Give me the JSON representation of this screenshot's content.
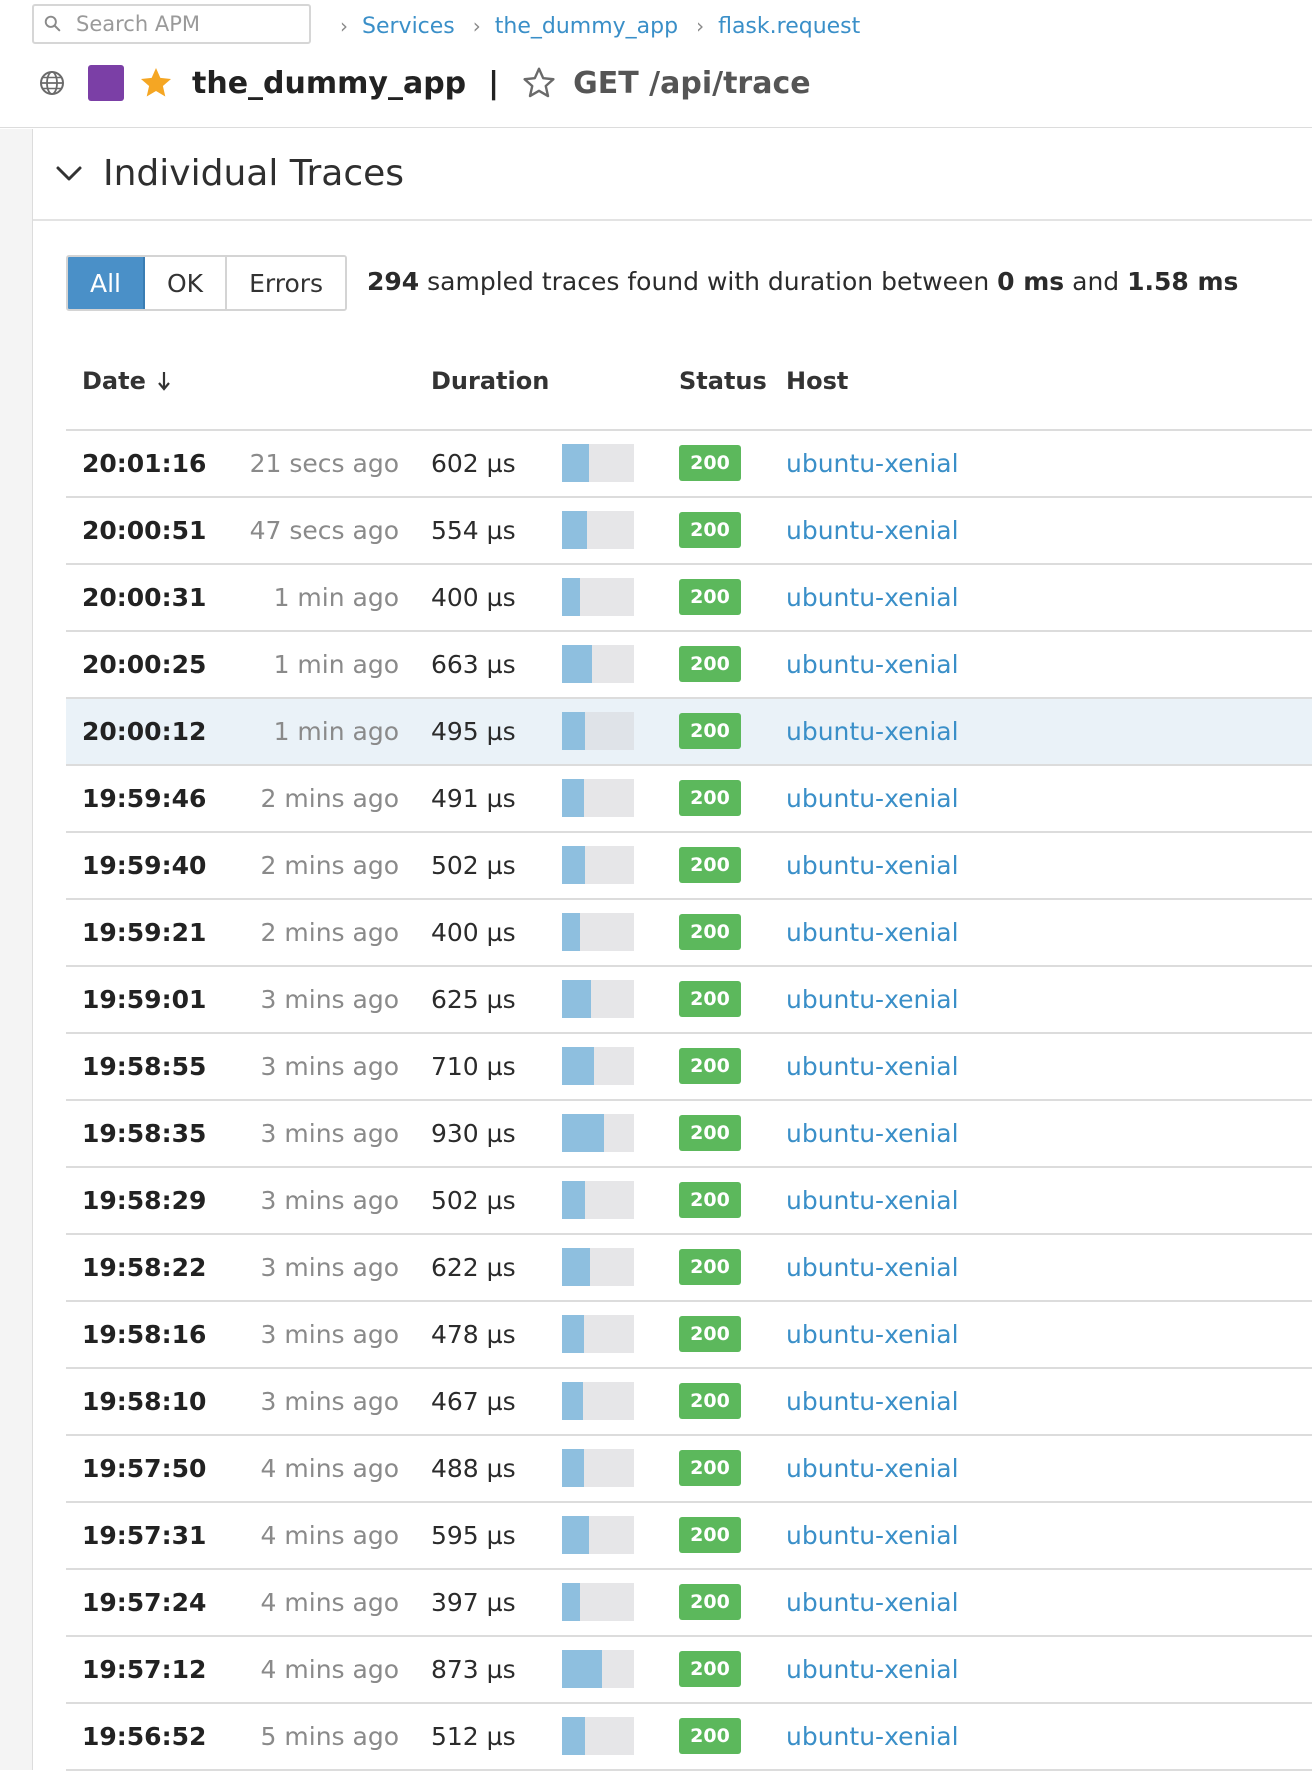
{
  "search": {
    "placeholder": "Search APM"
  },
  "breadcrumb": {
    "items": [
      {
        "label": "Services"
      },
      {
        "label": "the_dummy_app"
      },
      {
        "label": "flask.request"
      }
    ]
  },
  "header": {
    "service_color": "#7b3fa6",
    "service_name": "the_dummy_app",
    "separator": "|",
    "resource": "GET /api/trace",
    "icons": [
      "globe-icon",
      "star-filled-icon",
      "star-outline-icon"
    ]
  },
  "section": {
    "title": "Individual Traces"
  },
  "filters": {
    "options": [
      {
        "label": "All",
        "active": true
      },
      {
        "label": "OK",
        "active": false
      },
      {
        "label": "Errors",
        "active": false
      }
    ]
  },
  "summary": {
    "count": "294",
    "text_1": " sampled traces found with duration between ",
    "min": "0 ms",
    "text_2": " and ",
    "max": "1.58 ms"
  },
  "table": {
    "columns": {
      "date": "Date",
      "duration": "Duration",
      "status": "Status",
      "host": "Host"
    },
    "duration_bar_max_us": 1580,
    "rows": [
      {
        "time": "20:01:16",
        "ago": "21 secs ago",
        "duration": "602 µs",
        "duration_us": 602,
        "status": "200",
        "host": "ubuntu-xenial"
      },
      {
        "time": "20:00:51",
        "ago": "47 secs ago",
        "duration": "554 µs",
        "duration_us": 554,
        "status": "200",
        "host": "ubuntu-xenial"
      },
      {
        "time": "20:00:31",
        "ago": "1 min ago",
        "duration": "400 µs",
        "duration_us": 400,
        "status": "200",
        "host": "ubuntu-xenial"
      },
      {
        "time": "20:00:25",
        "ago": "1 min ago",
        "duration": "663 µs",
        "duration_us": 663,
        "status": "200",
        "host": "ubuntu-xenial"
      },
      {
        "time": "20:00:12",
        "ago": "1 min ago",
        "duration": "495 µs",
        "duration_us": 495,
        "status": "200",
        "host": "ubuntu-xenial",
        "hover": true
      },
      {
        "time": "19:59:46",
        "ago": "2 mins ago",
        "duration": "491 µs",
        "duration_us": 491,
        "status": "200",
        "host": "ubuntu-xenial"
      },
      {
        "time": "19:59:40",
        "ago": "2 mins ago",
        "duration": "502 µs",
        "duration_us": 502,
        "status": "200",
        "host": "ubuntu-xenial"
      },
      {
        "time": "19:59:21",
        "ago": "2 mins ago",
        "duration": "400 µs",
        "duration_us": 400,
        "status": "200",
        "host": "ubuntu-xenial"
      },
      {
        "time": "19:59:01",
        "ago": "3 mins ago",
        "duration": "625 µs",
        "duration_us": 625,
        "status": "200",
        "host": "ubuntu-xenial"
      },
      {
        "time": "19:58:55",
        "ago": "3 mins ago",
        "duration": "710 µs",
        "duration_us": 710,
        "status": "200",
        "host": "ubuntu-xenial"
      },
      {
        "time": "19:58:35",
        "ago": "3 mins ago",
        "duration": "930 µs",
        "duration_us": 930,
        "status": "200",
        "host": "ubuntu-xenial"
      },
      {
        "time": "19:58:29",
        "ago": "3 mins ago",
        "duration": "502 µs",
        "duration_us": 502,
        "status": "200",
        "host": "ubuntu-xenial"
      },
      {
        "time": "19:58:22",
        "ago": "3 mins ago",
        "duration": "622 µs",
        "duration_us": 622,
        "status": "200",
        "host": "ubuntu-xenial"
      },
      {
        "time": "19:58:16",
        "ago": "3 mins ago",
        "duration": "478 µs",
        "duration_us": 478,
        "status": "200",
        "host": "ubuntu-xenial"
      },
      {
        "time": "19:58:10",
        "ago": "3 mins ago",
        "duration": "467 µs",
        "duration_us": 467,
        "status": "200",
        "host": "ubuntu-xenial"
      },
      {
        "time": "19:57:50",
        "ago": "4 mins ago",
        "duration": "488 µs",
        "duration_us": 488,
        "status": "200",
        "host": "ubuntu-xenial"
      },
      {
        "time": "19:57:31",
        "ago": "4 mins ago",
        "duration": "595 µs",
        "duration_us": 595,
        "status": "200",
        "host": "ubuntu-xenial"
      },
      {
        "time": "19:57:24",
        "ago": "4 mins ago",
        "duration": "397 µs",
        "duration_us": 397,
        "status": "200",
        "host": "ubuntu-xenial"
      },
      {
        "time": "19:57:12",
        "ago": "4 mins ago",
        "duration": "873 µs",
        "duration_us": 873,
        "status": "200",
        "host": "ubuntu-xenial"
      },
      {
        "time": "19:56:52",
        "ago": "5 mins ago",
        "duration": "512 µs",
        "duration_us": 512,
        "status": "200",
        "host": "ubuntu-xenial"
      }
    ]
  },
  "colors": {
    "link": "#3a8fc8",
    "status_ok": "#5cb85c",
    "filter_active": "#4a90c8",
    "duration_bar": "#8ebfdf"
  }
}
